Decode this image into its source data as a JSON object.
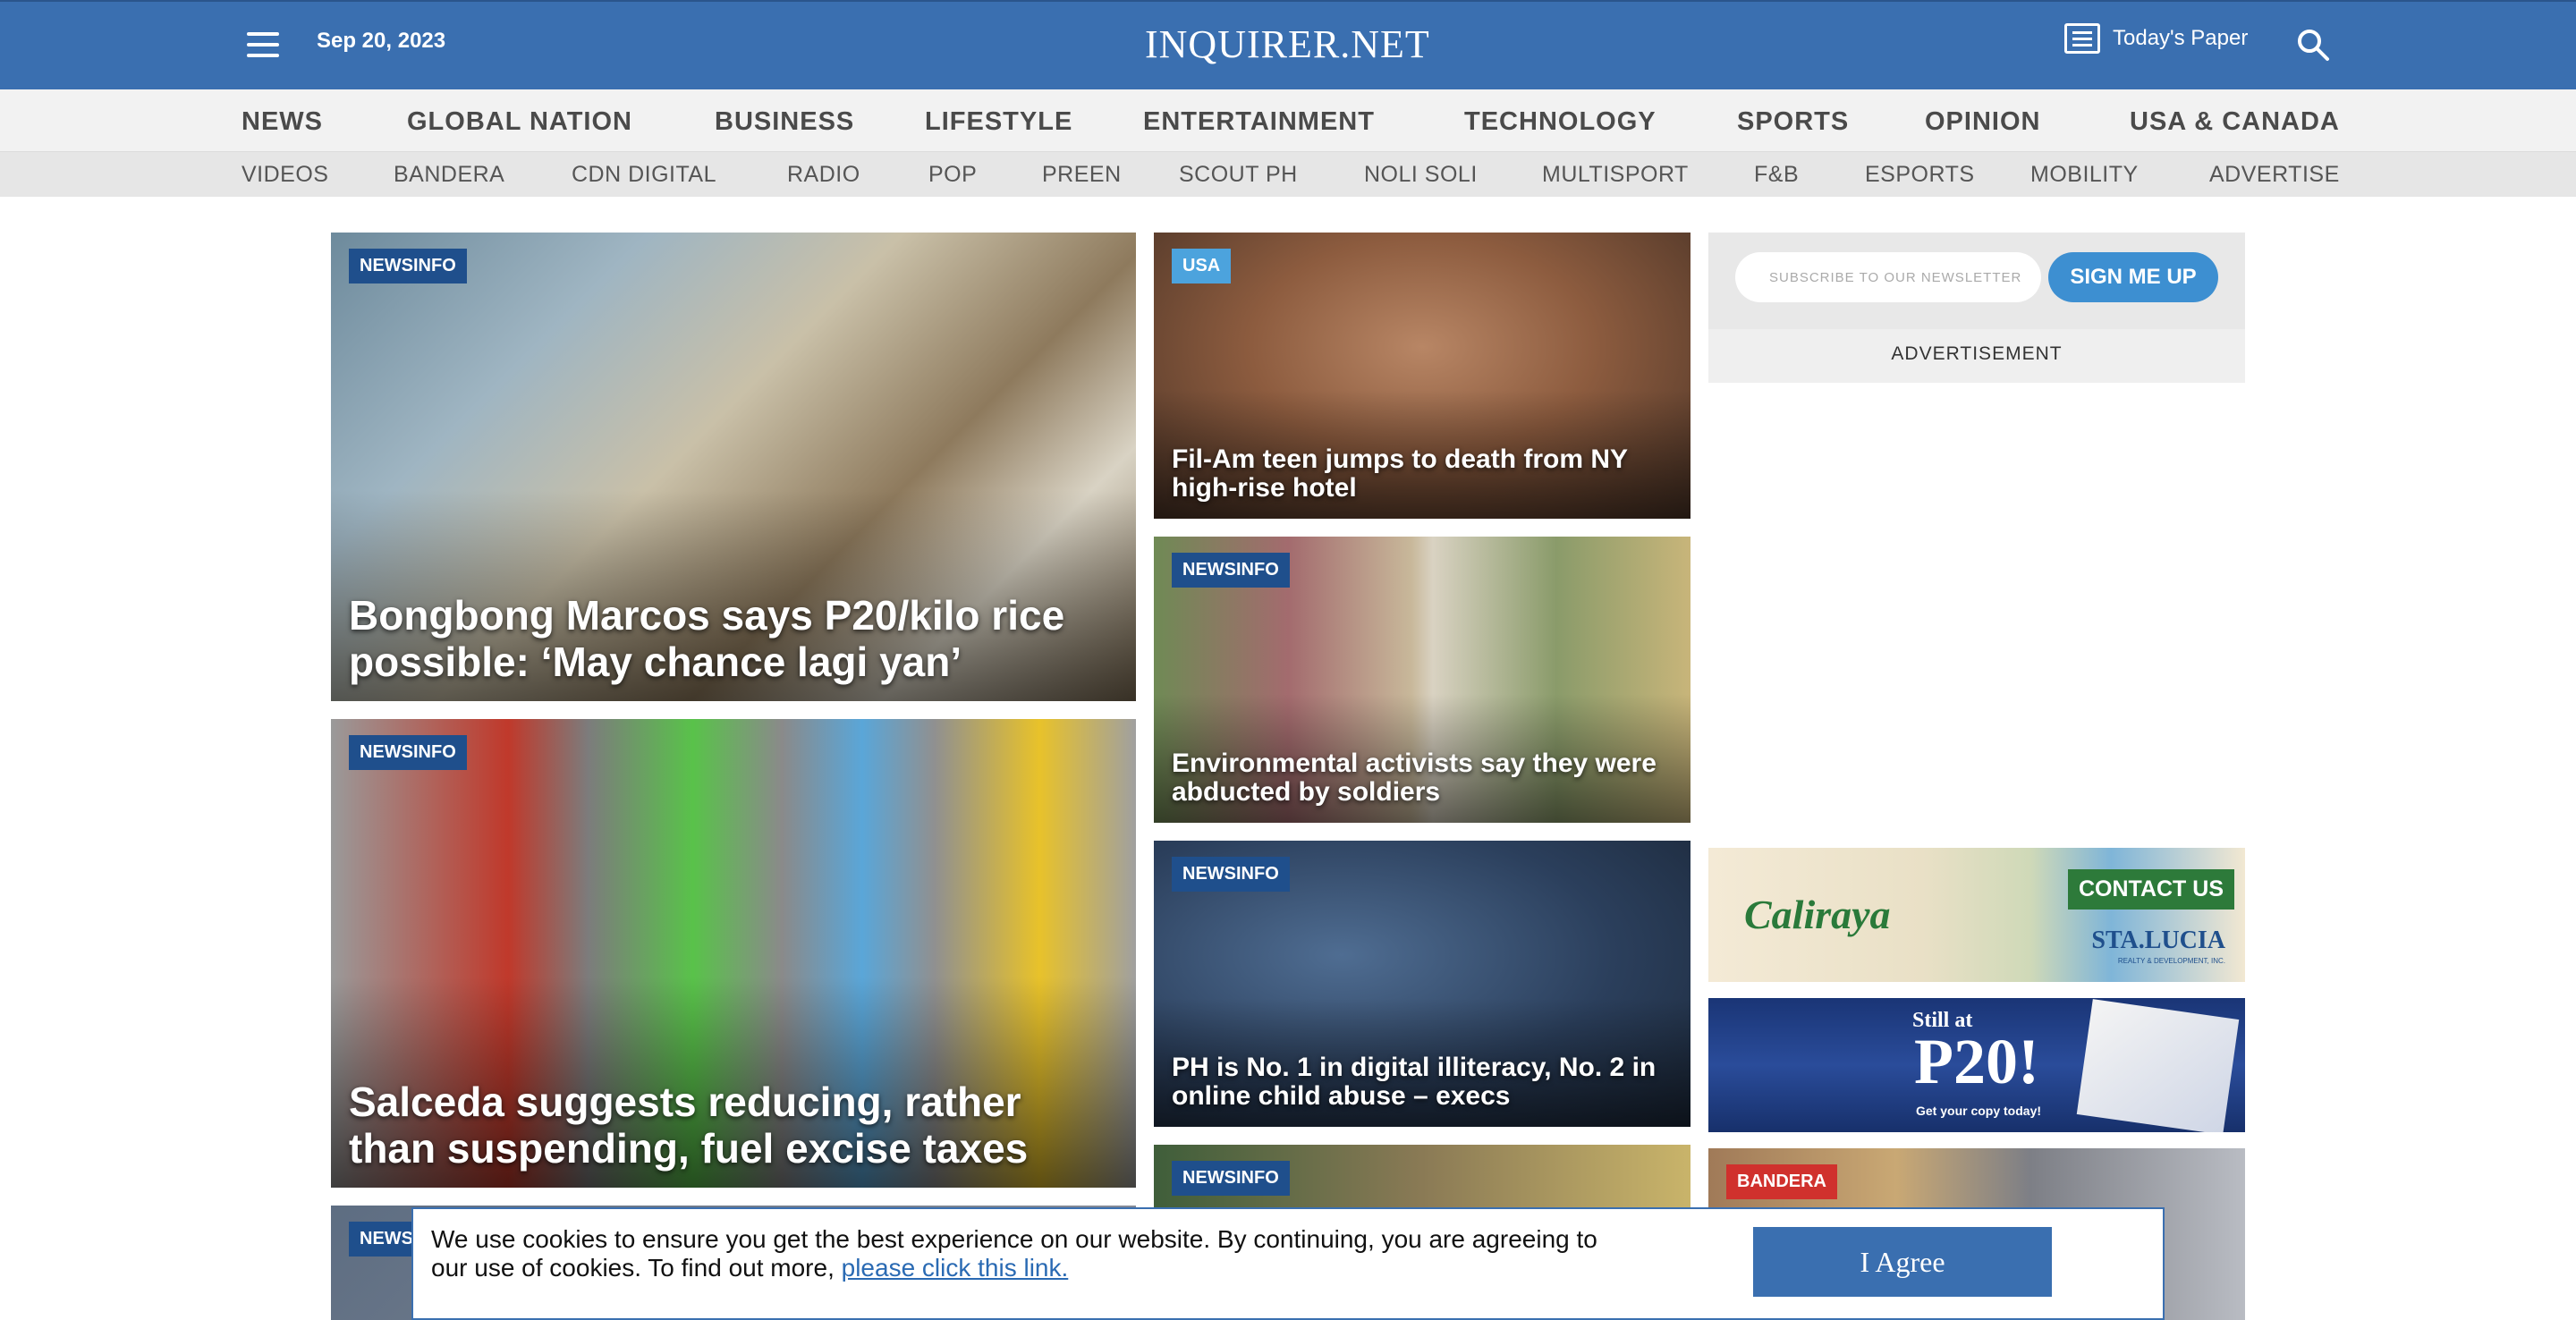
{
  "header": {
    "date": "Sep 20, 2023",
    "logo": "INQUIRER.NET",
    "todays_paper": "Today's Paper"
  },
  "nav_main": [
    "NEWS",
    "GLOBAL NATION",
    "BUSINESS",
    "LIFESTYLE",
    "ENTERTAINMENT",
    "TECHNOLOGY",
    "SPORTS",
    "OPINION",
    "USA & CANADA"
  ],
  "nav_sub": [
    "VIDEOS",
    "BANDERA",
    "CDN DIGITAL",
    "RADIO",
    "POP",
    "PREEN",
    "SCOUT PH",
    "NOLI SOLI",
    "MULTISPORT",
    "F&B",
    "ESPORTS",
    "MOBILITY",
    "ADVERTISE"
  ],
  "stories": [
    {
      "badge": "NEWSINFO",
      "headline": "Bongbong Marcos says P20/kilo rice possible: ‘May chance lagi yan’"
    },
    {
      "badge": "NEWSINFO",
      "headline": "Salceda suggests reducing, rather than suspending, fuel excise taxes"
    },
    {
      "badge": "NEWS"
    },
    {
      "badge": "USA",
      "headline": "Fil-Am teen jumps to death from NY high-rise hotel"
    },
    {
      "badge": "NEWSINFO",
      "headline": "Environmental activists say they were abducted by soldiers"
    },
    {
      "badge": "NEWSINFO",
      "headline": "PH is No. 1 in digital illiteracy, No. 2 in online child abuse – execs"
    },
    {
      "badge": "NEWSINFO"
    },
    {
      "badge": "BANDERA"
    }
  ],
  "newsletter": {
    "placeholder": "SUBSCRIBE TO OUR NEWSLETTER",
    "button": "SIGN ME UP",
    "ad_label": "ADVERTISEMENT"
  },
  "ads": {
    "ad1": {
      "brand": "Caliraya",
      "cta": "CONTACT US",
      "company": "STA.LUCIA",
      "company_sub": "REALTY & DEVELOPMENT, INC."
    },
    "ad2": {
      "line1": "Still at",
      "price": "P20!",
      "line2": "Get your copy today!"
    }
  },
  "cookie": {
    "text": "We use cookies to ensure you get the best experience on our website. By continuing, you are agreeing to our use of cookies. To find out more, ",
    "link": "please click this link.",
    "button": "I Agree"
  },
  "colors": {
    "brand_blue": "#3a6fb0",
    "badge_navy": "#1f4f8c",
    "badge_usa": "#4ca3dd",
    "badge_bandera": "#d0312d"
  }
}
